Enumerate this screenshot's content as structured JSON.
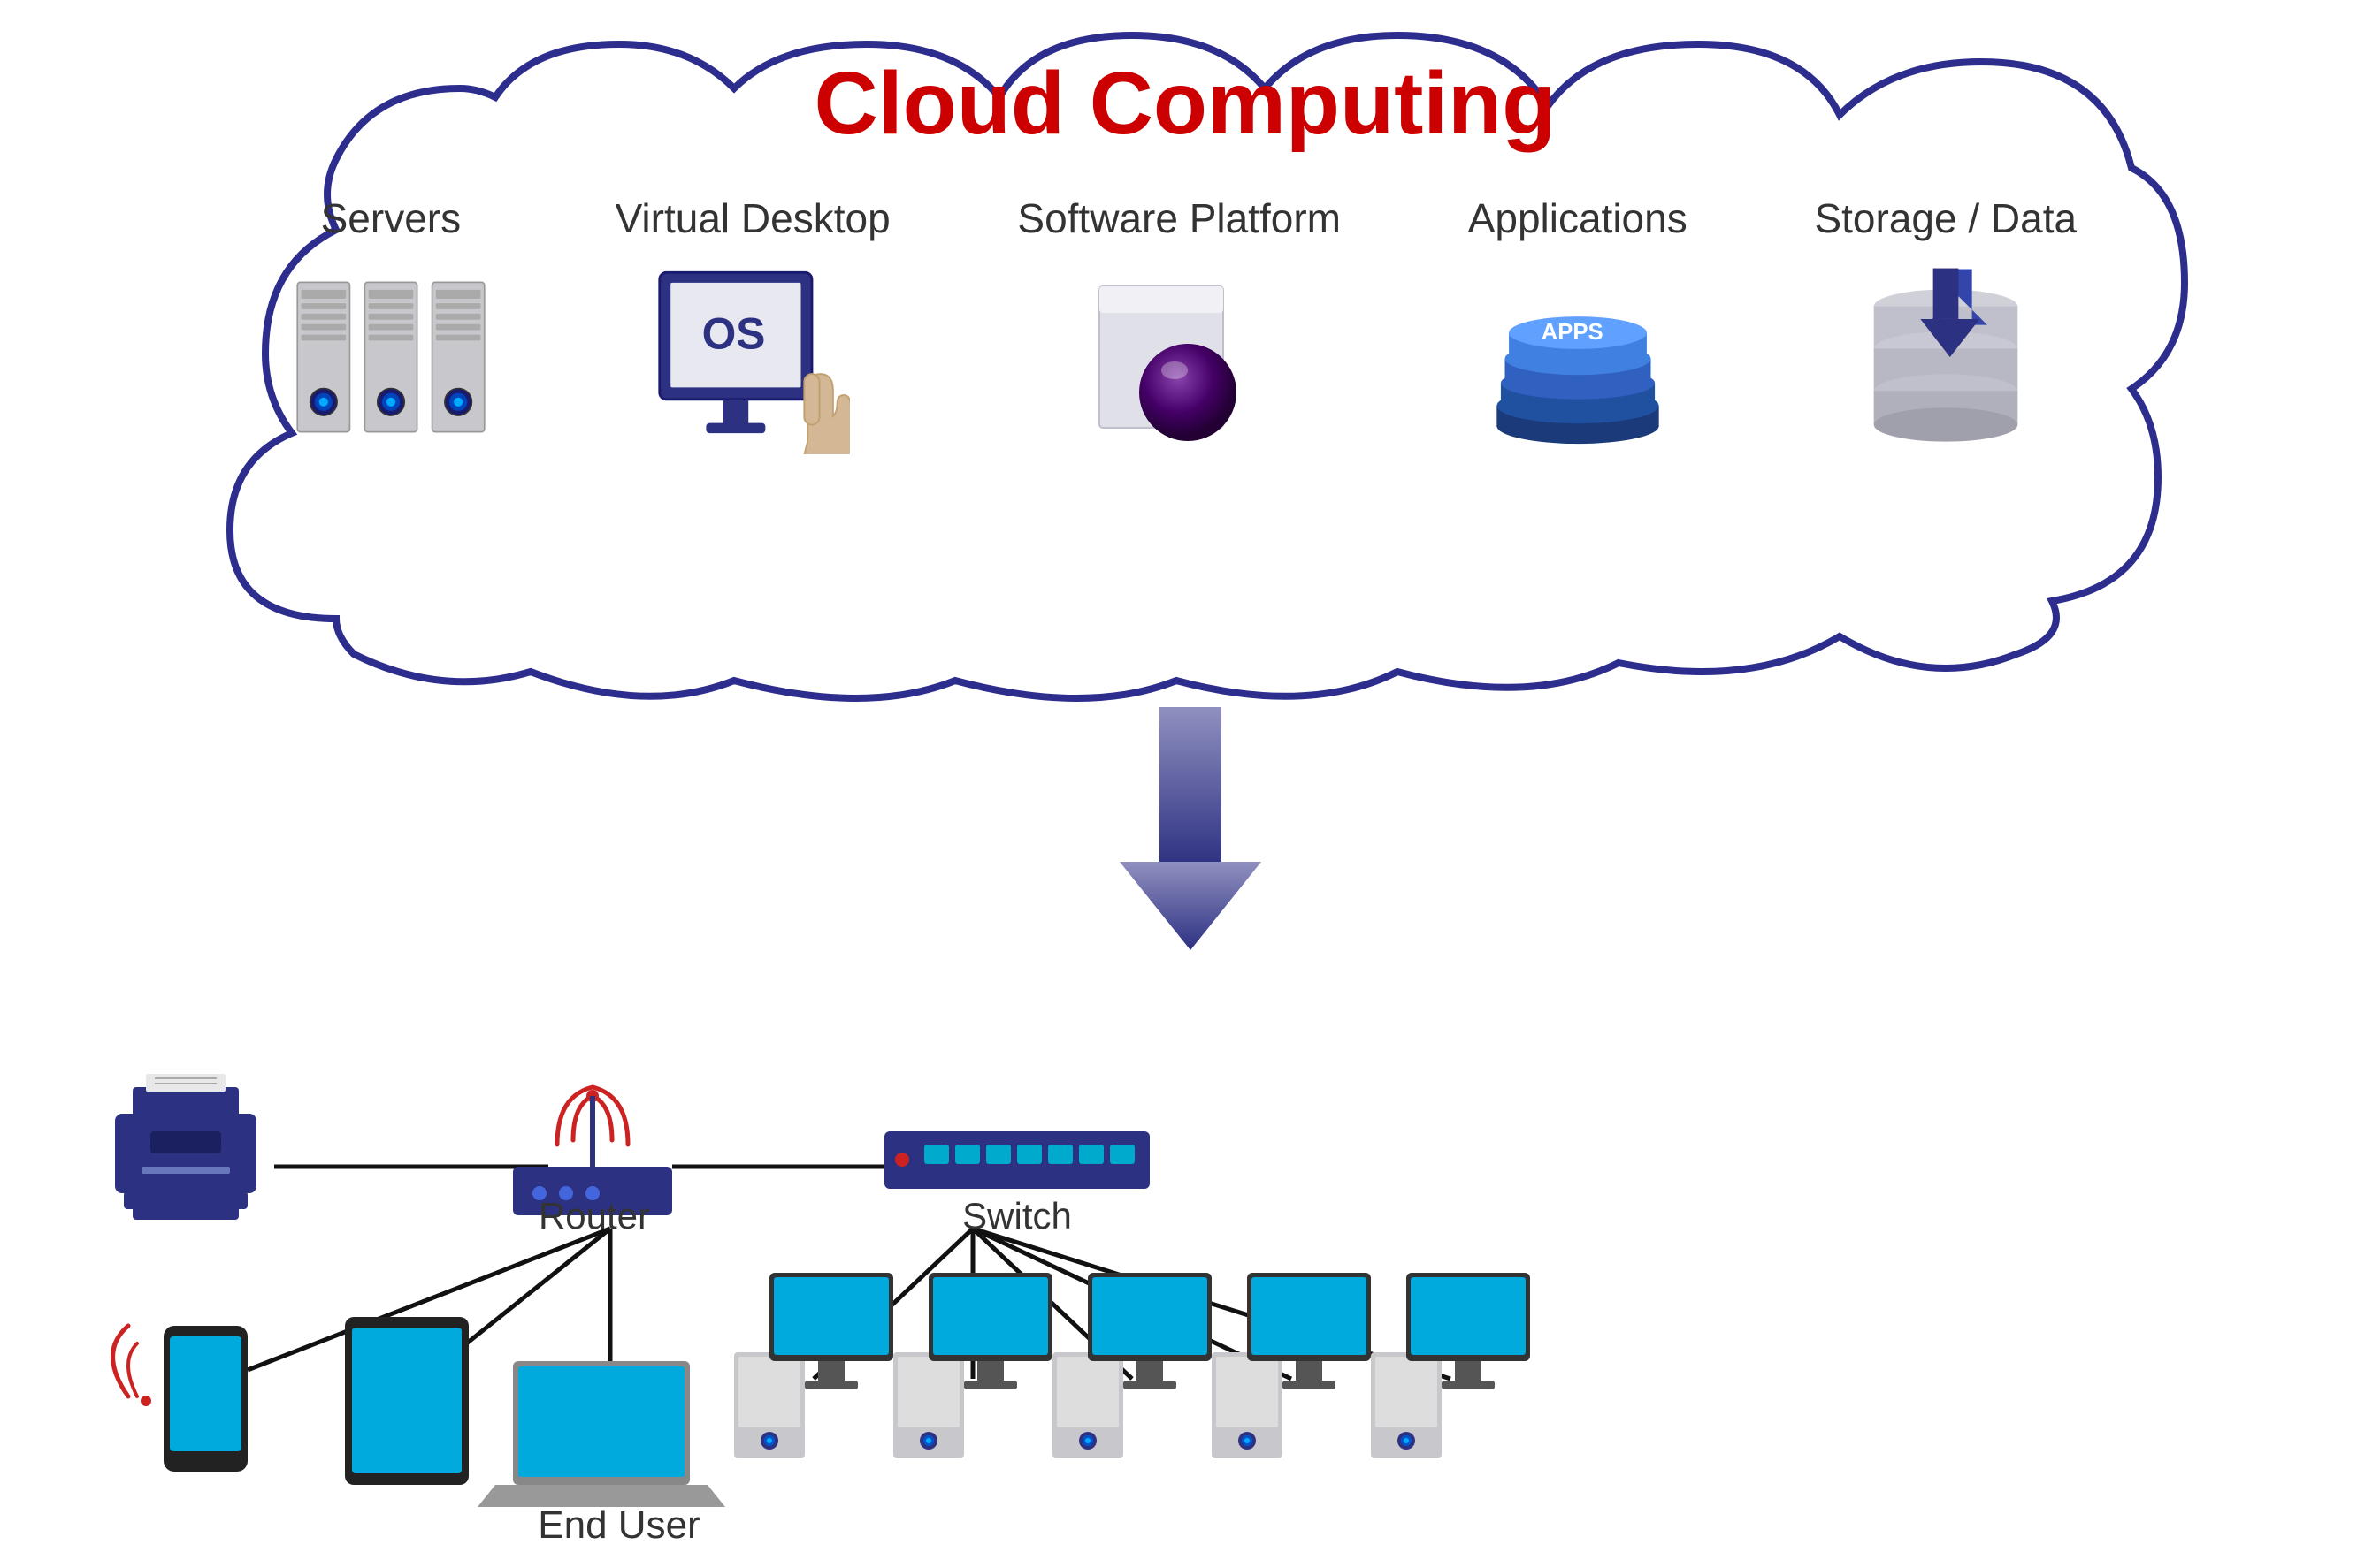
{
  "cloud": {
    "title": "Cloud Computing",
    "items": [
      {
        "label": "Servers",
        "icon": "servers-icon"
      },
      {
        "label": "Virtual Desktop",
        "icon": "virtual-desktop-icon"
      },
      {
        "label": "Software Platform",
        "icon": "software-platform-icon"
      },
      {
        "label": "Applications",
        "icon": "applications-icon"
      },
      {
        "label": "Storage / Data",
        "icon": "storage-icon"
      }
    ]
  },
  "network": {
    "router_label": "Router",
    "switch_label": "Switch",
    "end_user_label": "End User"
  },
  "colors": {
    "cloud_title": "#cc0000",
    "cloud_border": "#2d2d8e",
    "navy": "#2d3182",
    "arrow_color": "#5a5a9e",
    "cyan": "#00b4d8"
  }
}
